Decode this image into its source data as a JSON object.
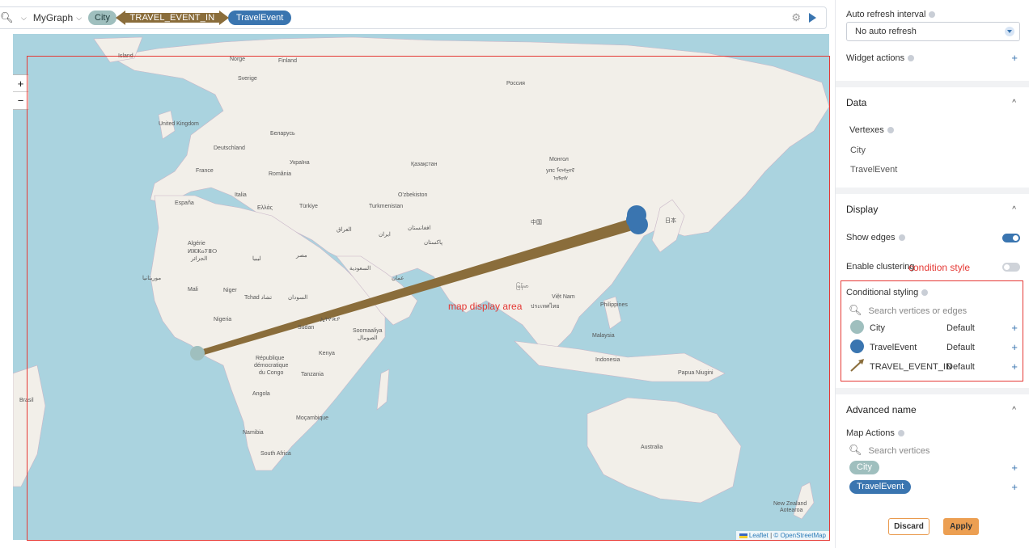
{
  "query_bar": {
    "graph_name": "MyGraph",
    "source_vertex": "City",
    "edge": "TRAVEL_EVENT_IN",
    "target_vertex": "TravelEvent"
  },
  "colors": {
    "city": "#9fbfbe",
    "travel_event": "#3a75b0",
    "edge": "#8a6d3b",
    "annotation": "#e53935",
    "apply": "#ec9f52"
  },
  "map": {
    "zoom_in": "+",
    "zoom_out": "−",
    "annotation": "map display area",
    "attribution_leaflet": "Leaflet",
    "attribution_sep": "|",
    "attribution_osm": "© OpenStreetMap",
    "labels": [
      {
        "text": "Island"
      },
      {
        "text": "Norge"
      },
      {
        "text": "Finland"
      },
      {
        "text": "Sverige"
      },
      {
        "text": "Россия"
      },
      {
        "text": "United Kingdom"
      },
      {
        "text": "Беларусь"
      },
      {
        "text": "Deutschland"
      },
      {
        "text": "Україна"
      },
      {
        "text": "France"
      },
      {
        "text": "România"
      },
      {
        "text": "Қазақстан"
      },
      {
        "text": "Монгол"
      },
      {
        "text": "улс ᠮᠣᠩᠭᠣᠯ"
      },
      {
        "text": "ᠤᠯᠤᠰ"
      },
      {
        "text": "Italia"
      },
      {
        "text": "España"
      },
      {
        "text": "Ελλάς"
      },
      {
        "text": "Türkiye"
      },
      {
        "text": "O'zbekiston"
      },
      {
        "text": "Turkmenistan"
      },
      {
        "text": "中国"
      },
      {
        "text": "日本"
      },
      {
        "text": "العراق"
      },
      {
        "text": "ایران"
      },
      {
        "text": "افغانستان"
      },
      {
        "text": "پاکستان"
      },
      {
        "text": "Algérie"
      },
      {
        "text": "ⵍⵣⵣⴰⵢⴻⵔ"
      },
      {
        "text": "الجزائر"
      },
      {
        "text": "ليبيا"
      },
      {
        "text": "مصر"
      },
      {
        "text": "السعودية"
      },
      {
        "text": "موريتانيا"
      },
      {
        "text": "Mali"
      },
      {
        "text": "Niger"
      },
      {
        "text": "Tchad تشاد"
      },
      {
        "text": "السودان"
      },
      {
        "text": "ኢትዮጵያ"
      },
      {
        "text": "Nigeria"
      },
      {
        "text": "Sudan"
      },
      {
        "text": "Soomaaliya"
      },
      {
        "text": "الصومال"
      },
      {
        "text": "République"
      },
      {
        "text": "démocratique"
      },
      {
        "text": "du Congo"
      },
      {
        "text": "Kenya"
      },
      {
        "text": "Tanzania"
      },
      {
        "text": "Angola"
      },
      {
        "text": "Namibia"
      },
      {
        "text": "Moçambique"
      },
      {
        "text": "South Africa"
      },
      {
        "text": "Brasil"
      },
      {
        "text": "မြန်မာ"
      },
      {
        "text": "Việt Nam"
      },
      {
        "text": "ประเทศไทย"
      },
      {
        "text": "Philippines"
      },
      {
        "text": "Malaysia"
      },
      {
        "text": "Indonesia"
      },
      {
        "text": "Papua Niugini"
      },
      {
        "text": "Australia"
      },
      {
        "text": "New Zealand"
      },
      {
        "text": "Aotearoa"
      },
      {
        "text": "عمان"
      }
    ]
  },
  "panel": {
    "auto_refresh_label": "Auto refresh interval",
    "auto_refresh_value": "No auto refresh",
    "widget_actions_label": "Widget actions",
    "plus": "+",
    "caret_up": "^",
    "data_title": "Data",
    "vertexes_label": "Vertexes",
    "vertexes": [
      "City",
      "TravelEvent"
    ],
    "display_title": "Display",
    "show_edges_label": "Show edges",
    "show_edges_on": true,
    "clustering_label": "Enable clustering",
    "clustering_on": false,
    "clustering_annotation": "condition style",
    "conditional_label": "Conditional styling",
    "search_vertices_edges": "Search vertices or edges",
    "conditional_rows": [
      {
        "name": "City",
        "style": "Default"
      },
      {
        "name": "TravelEvent",
        "style": "Default"
      },
      {
        "name": "TRAVEL_EVENT_IN",
        "style": "Default"
      }
    ],
    "advanced_title": "Advanced name",
    "map_actions_label": "Map Actions",
    "search_vertices": "Search vertices",
    "map_action_chips": [
      "City",
      "TravelEvent"
    ],
    "discard_label": "Discard",
    "apply_label": "Apply"
  }
}
